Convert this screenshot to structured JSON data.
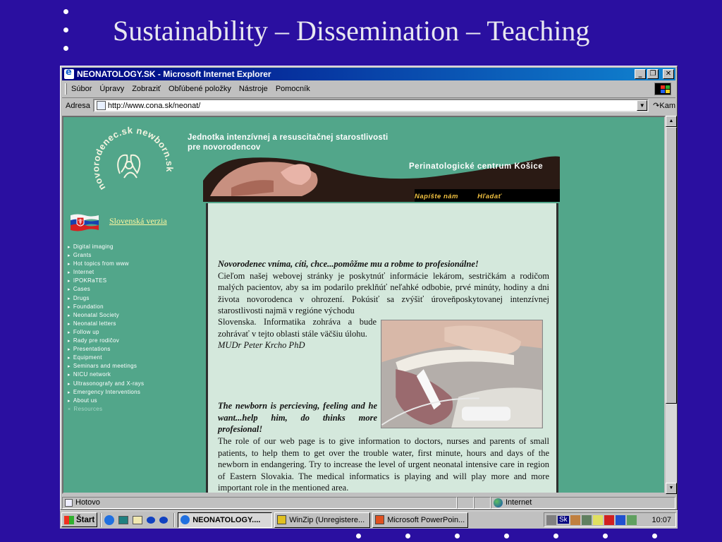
{
  "slide": {
    "title": "Sustainability – Dissemination – Teaching"
  },
  "browser": {
    "title": "NEONATOLOGY.SK - Microsoft Internet Explorer",
    "menu": [
      "Súor",
      "Úpravy",
      "Zobraziť",
      "Obľúbené položky",
      "Nástroje",
      "Pomocník"
    ],
    "menu_full": {
      "file": "Súbor",
      "edit": "Úpravy",
      "view": "Zobraziť",
      "favorites": "Obľúbené položky",
      "tools": "Nástroje",
      "help": "Pomocník"
    },
    "address_label": "Adresa",
    "url": "http://www.cona.sk/neonat/",
    "go_label": "Kam",
    "status_text": "Hotovo",
    "zone_text": "Internet"
  },
  "page": {
    "logo_text": "novorodenec.sk newborn.sk",
    "slovak_link": "Slovenská verzia",
    "header_line1": "Jednotka intenzívnej a resuscitačnej starostlivosti",
    "header_line2": "pre novorodencov",
    "center_label": "Perinatologické centrum Košice",
    "top_links": {
      "write": "Napíšte nám",
      "search": "Hľadať"
    },
    "nav": [
      "Digital imaging",
      "Grants",
      "Hot topics from www",
      "Internet",
      "IPOKRaTES",
      "Cases",
      "Drugs",
      "Foundation",
      "Neonatal Society",
      "Neonatal letters",
      "Follow up",
      "Rady pre rodičov",
      "Presentations",
      "Equipment",
      "Seminars and meetings",
      "NICU network",
      "Ultrasonografy and X-rays",
      "Emergency Interventions",
      "About us"
    ],
    "nav_last": "Resources",
    "sk_heading": "Novorodenec vníma, cíti, chce...pomôžme mu a robme to profesionálne!",
    "sk_body_full": "Cieľom našej webovej stránky je poskytnúť informácie lekárom, sestričkám a rodičom malých pacientov, aby sa im podarilo preklenoúť neľahké odbobie, prvé minúty, hodiny a dni života novorodenca v ohrození. Pokušit sa zvýšiť úroveňposkytovanej intenzívnej starostlivosti najmä v regióne východu",
    "sk_body_a": "Cieľom našej webovej stránky je poskytnúť informácie lekárom, sestričkám a rodičom malých pacientov, aby sa im podarilo preklňúť neľahké odbobie, prvé minúty, hodiny a dni života novorodenca v ohrození. Pokúsiť sa zvýšiť úroveňposkytovanej intenzívnej starostlivosti najmä v regióne východu",
    "sk_body_b": "Slovenska. Informatika zohráva a bude zohrávať v tejto oblasti stále väčšiu úlohu.",
    "signature": "MUDr Peter Krcho PhD",
    "en_heading": "The newborn is percieving, feeling and he want...help him, do thinks more profesional!",
    "en_body": "The role of our web page is to give information to doctors, nurses and parents of small patients, to help them to get over the trouble water, first minute, hours and days of the newborn in endangering. Try to increase the level of urgent neonatal intensive care in region of Eastern Slovakia. The medical informatics is playing and will play more and more important role in the mentioned area."
  },
  "taskbar": {
    "start": "Štart",
    "tasks": [
      "NEONATOLOGY....",
      "WinZip (Unregistere...",
      "Microsoft PowerPoin..."
    ],
    "clock": "10:07",
    "tray_lang": "Sk"
  },
  "colors": {
    "slide_bg": "#2a0fa0",
    "page_bg": "#52a68a",
    "panel_bg": "#d4e8dc",
    "titlebar": "#000080"
  }
}
